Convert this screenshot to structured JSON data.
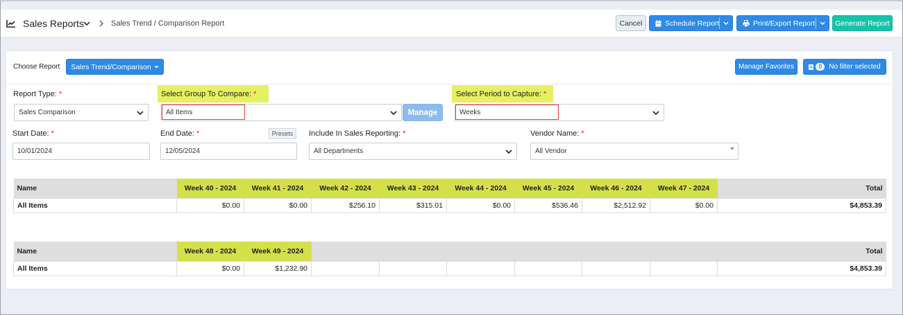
{
  "header": {
    "title": "Sales Reports",
    "breadcrumb": "Sales Trend / Comparison Report",
    "cancel_label": "Cancel",
    "schedule_label": "Schedule Report",
    "print_label": "Print/Export Report",
    "generate_label": "Generate Report"
  },
  "filters": {
    "choose_report_label": "Choose Report",
    "report_button_label": "Sales Trend/Comparison",
    "manage_favorites_label": "Manage Favorites",
    "filter_count": "0",
    "filter_status": "No filter selected",
    "report_type": {
      "label": "Report Type:",
      "value": "Sales Comparison"
    },
    "group_compare": {
      "label": "Select Group To Compare:",
      "value": "All Items"
    },
    "manage_label": "Manage",
    "period": {
      "label": "Select Period to Capture:",
      "value": "Weeks"
    },
    "start_date": {
      "label": "Start Date:",
      "value": "10/01/2024"
    },
    "end_date": {
      "label": "End Date:",
      "value": "12/05/2024"
    },
    "presets_label": "Presets",
    "include_sales": {
      "label": "Include In Sales Reporting:",
      "value": "All Departments"
    },
    "vendor": {
      "label": "Vendor Name:",
      "value": "All Vendor"
    },
    "required_mark": "*"
  },
  "table1": {
    "name_header": "Name",
    "total_header": "Total",
    "weeks": [
      "Week 40 - 2024",
      "Week 41 - 2024",
      "Week 42 - 2024",
      "Week 43 - 2024",
      "Week 44 - 2024",
      "Week 45 - 2024",
      "Week 46 - 2024",
      "Week 47 - 2024"
    ],
    "row_name": "All Items",
    "values": [
      "$0.00",
      "$0.00",
      "$256.10",
      "$315.01",
      "$0.00",
      "$536.46",
      "$2,512.92",
      "$0.00"
    ],
    "total": "$4,853.39"
  },
  "table2": {
    "name_header": "Name",
    "total_header": "Total",
    "weeks": [
      "Week 48 - 2024",
      "Week 49 - 2024",
      "",
      "",
      "",
      "",
      "",
      ""
    ],
    "row_name": "All Items",
    "values": [
      "$0.00",
      "$1,232.90",
      "",
      "",
      "",
      "",
      "",
      ""
    ],
    "total": "$4,853.39"
  },
  "colors": {
    "primary": "#2e8ae6",
    "teal": "#17c3a8",
    "highlight": "#e6f060",
    "required": "#e0202a"
  }
}
